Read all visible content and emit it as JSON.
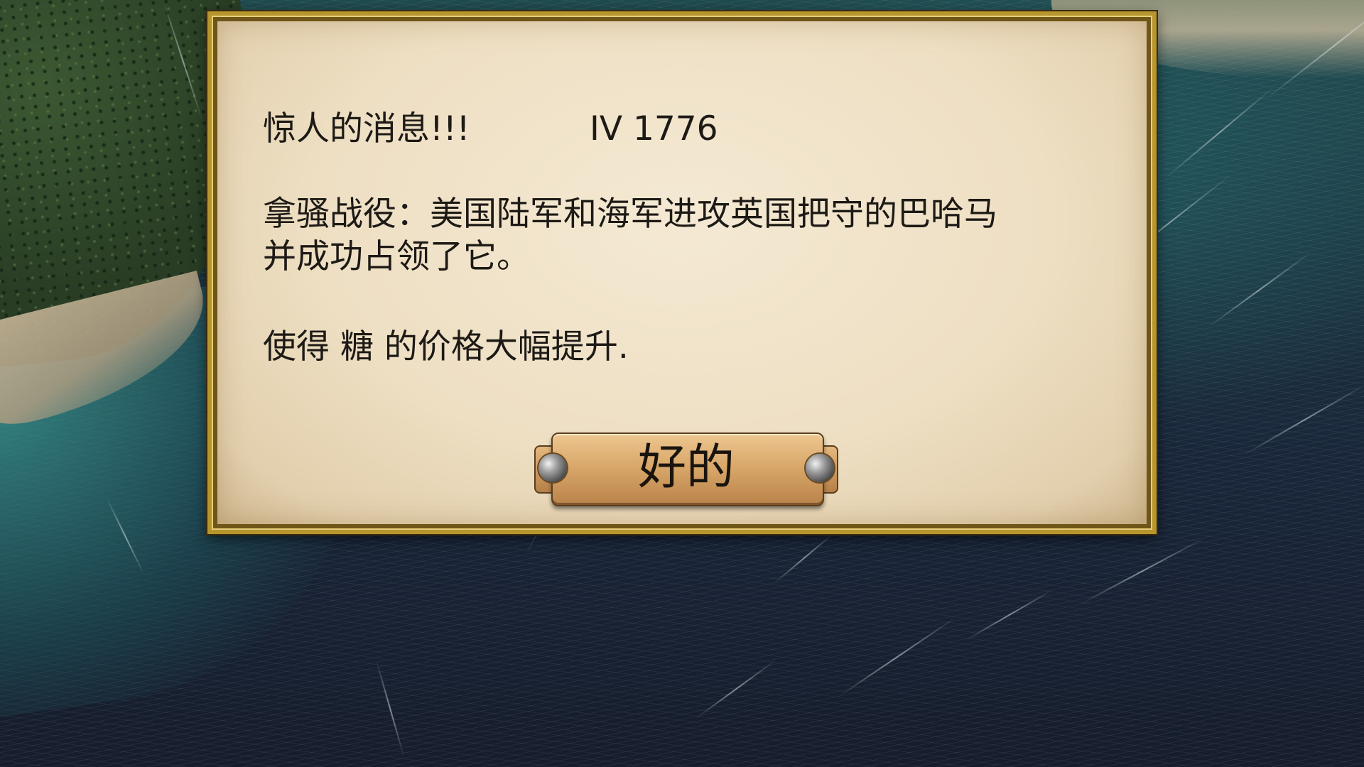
{
  "dialog": {
    "title": "惊人的消息!!!",
    "date": "IV 1776",
    "body_line1": "拿骚战役：美国陆军和海军进攻英国把守的巴哈马",
    "body_line2": "并成功占领了它。",
    "effect": "使得 糖 的价格大幅提升.",
    "ok_label": "好的"
  },
  "colors": {
    "parchment": "#eedfc3",
    "frame_gold": "#b8962e",
    "button_bronze": "#d9a86a",
    "text": "#1d1a16",
    "sea": "#19263a"
  }
}
